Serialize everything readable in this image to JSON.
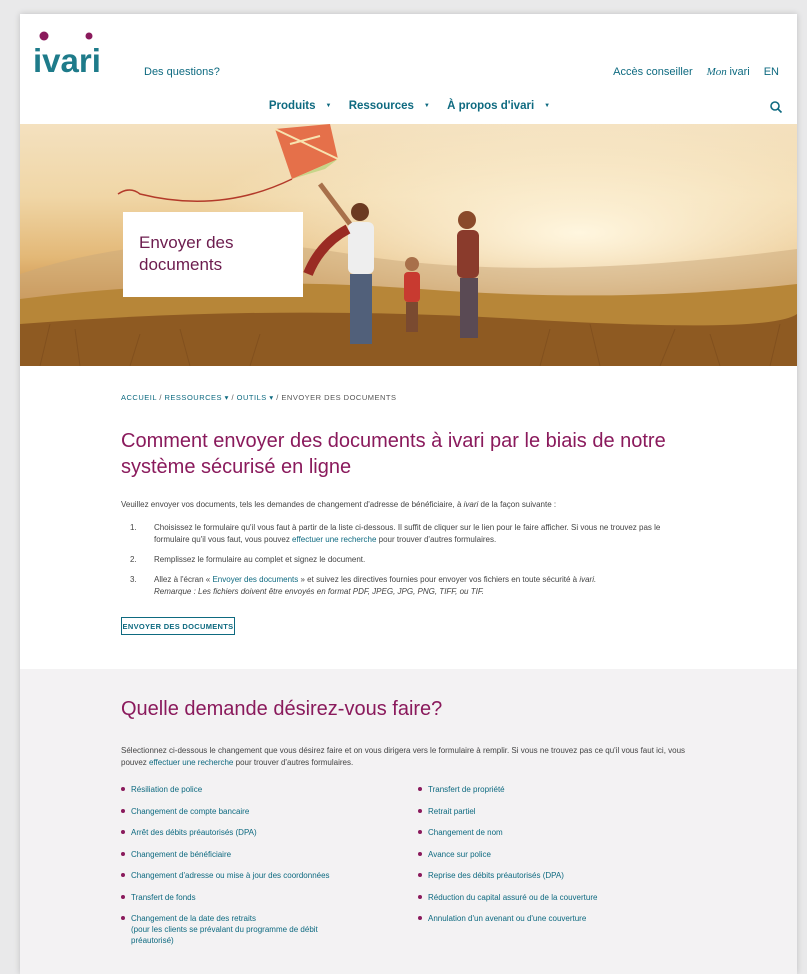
{
  "header": {
    "logo_text": "ivari",
    "questions": "Des questions?",
    "advisor_access": "Accès conseiller",
    "mon_script": "Mon",
    "mon_word": "ivari",
    "language": "EN"
  },
  "nav": {
    "items": [
      "Produits",
      "Ressources",
      "À propos d'ivari"
    ]
  },
  "hero": {
    "title_line1": "Envoyer des",
    "title_line2": "documents"
  },
  "breadcrumb": {
    "home": "ACCUEIL",
    "resources": "RESSOURCES",
    "tools": "OUTILS",
    "current": "ENVOYER DES DOCUMENTS",
    "sep": "/",
    "caret": "▾"
  },
  "main": {
    "title": "Comment envoyer des documents à ivari par le biais de notre système sécurisé en ligne",
    "intro_before": "Veuillez envoyer vos documents, tels les demandes de changement d'adresse de bénéficiaire, à ",
    "intro_brand": "ivari",
    "intro_after": " de la façon suivante :",
    "step1_num": "1.",
    "step1_before": "Choisissez le formulaire qu'il vous faut à partir de la liste ci-dessous. Il suffit de cliquer sur le lien pour le faire afficher. Si vous ne trouvez pas le formulaire qu'il vous faut, vous pouvez ",
    "step1_link": "effectuer une recherche",
    "step1_after": " pour trouver d'autres formulaires.",
    "step2_num": "2.",
    "step2": "Remplissez le formulaire au complet et signez le document.",
    "step3_num": "3.",
    "step3_before": "Allez à l'écran « ",
    "step3_link": "Envoyer des documents",
    "step3_mid": " » et suivez les directives fournies pour envoyer vos fichiers en toute sécurité à ",
    "step3_brand": "ivari.",
    "step3_note": "Remarque : Les fichiers doivent être envoyés en format PDF, JPEG, JPG, PNG, TIFF, ou TIF.",
    "button": "ENVOYER DES DOCUMENTS"
  },
  "section2": {
    "title": "Quelle demande désirez-vous faire?",
    "desc_before": "Sélectionnez ci-dessous le changement que vous désirez faire et on vous dirigera vers le formulaire à remplir. Si vous ne trouvez pas ce qu'il vous faut ici, vous pouvez ",
    "desc_link": "effectuer une recherche",
    "desc_after": " pour trouver d'autres formulaires.",
    "left_items": [
      "Résiliation de police",
      "Changement de compte bancaire",
      "Arrêt des débits préautorisés (DPA)",
      "Changement de bénéficiaire",
      "Changement d'adresse ou mise à jour des coordonnées",
      "Transfert de fonds",
      "Changement de la date des retraits",
      "(pour les clients se prévalant du programme de débit",
      "préautorisé)"
    ],
    "right_items": [
      "Transfert de propriété",
      "Retrait partiel",
      "Changement de nom",
      "Avance sur police",
      "Reprise des débits préautorisés (DPA)",
      "Réduction du capital assuré ou de la couverture",
      "Annulation d'un avenant ou d'une couverture"
    ]
  },
  "colors": {
    "brand_magenta": "#8a1a5c",
    "link_teal": "#0e6a80",
    "section_bg": "#f3f2f3"
  }
}
